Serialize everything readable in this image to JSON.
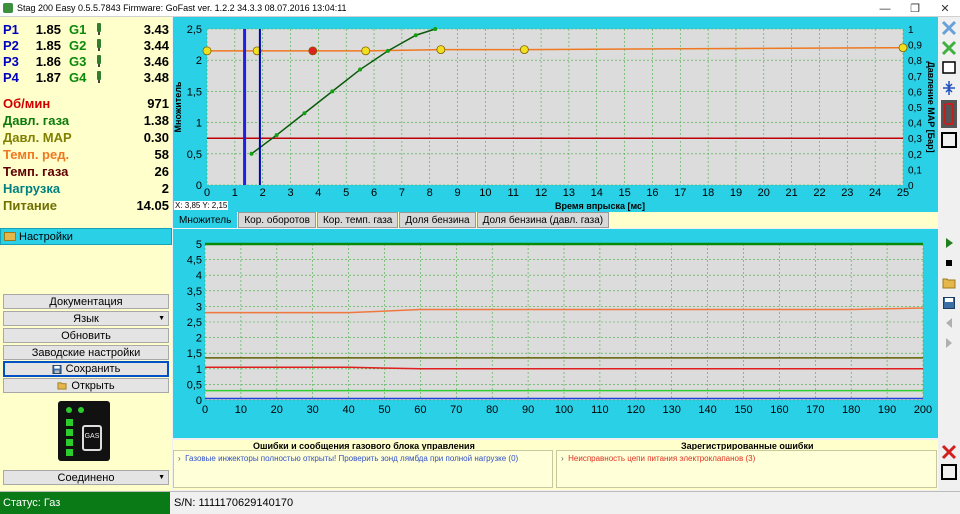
{
  "window": {
    "title": "Stag 200 Easy 0.5.5.7843 Firmware: GoFast  ver. 1.2.2  34.3.3   08.07.2016 13:04:11",
    "minimize": "—",
    "restore": "❐",
    "close": "✕"
  },
  "injectors": [
    {
      "p_label": "P1",
      "p_value": "1.85",
      "g_label": "G1",
      "g_value": "3.43"
    },
    {
      "p_label": "P2",
      "p_value": "1.85",
      "g_label": "G2",
      "g_value": "3.44"
    },
    {
      "p_label": "P3",
      "p_value": "1.86",
      "g_label": "G3",
      "g_value": "3.46"
    },
    {
      "p_label": "P4",
      "p_value": "1.87",
      "g_label": "G4",
      "g_value": "3.48"
    }
  ],
  "metrics": [
    {
      "label": "Об/мин",
      "value": "971",
      "color": "#d00000"
    },
    {
      "label": "Давл. газа",
      "value": "1.38",
      "color": "#0a7a0a"
    },
    {
      "label": "Давл. MAP",
      "value": "0.30",
      "color": "#808000"
    },
    {
      "label": "Темп. ред.",
      "value": "58",
      "color": "#f07820"
    },
    {
      "label": "Темп. газа",
      "value": "26",
      "color": "#600000"
    },
    {
      "label": "Нагрузка",
      "value": "2",
      "color": "#008080"
    },
    {
      "label": "Питание",
      "value": "14.05",
      "color": "#707000"
    }
  ],
  "sidebar": {
    "settings_label": "Настройки",
    "buttons": {
      "docs": "Документация",
      "language": "Язык",
      "update": "Обновить",
      "factory": "Заводские настройки",
      "save": "Сохранить",
      "open": "Открыть",
      "connection": "Соединено"
    },
    "device_gas": "GAS"
  },
  "chart1": {
    "ylabel": "Множитель",
    "xlabel": "Время впрыска [мс]",
    "y2label": "Давление MAP [Бар]",
    "coords": "X: 3,85  Y: 2,15"
  },
  "tabs": [
    "Множитель",
    "Кор. оборотов",
    "Кор. темп. газа",
    "Доля бензина",
    "Доля бензина (давл. газа)"
  ],
  "errors": {
    "left_title": "Ошибки и сообщения газового блока управления",
    "left_msg": "Газовые инжекторы полностью открыты! Проверить зонд лямбда при полной нагрузке (0)",
    "right_title": "Зарегистрированные ошибки",
    "right_msg": "Неисправность цепи питания электроклапанов (3)"
  },
  "status": {
    "state": "Статус: Газ",
    "serial": "S/N: 1111170629140170"
  },
  "chart_data": [
    {
      "type": "scatter",
      "xlabel": "Время впрыска [мс]",
      "ylabel": "Множитель",
      "y2label": "Давление MAP [Бар]",
      "xlim": [
        0,
        25
      ],
      "ylim": [
        0,
        2.5
      ],
      "y2lim": [
        0,
        1
      ],
      "xticks": [
        0,
        1,
        2,
        3,
        4,
        5,
        6,
        7,
        8,
        9,
        10,
        11,
        12,
        13,
        14,
        15,
        16,
        17,
        18,
        19,
        20,
        21,
        22,
        23,
        24,
        25
      ],
      "yticks": [
        "0",
        "0,5",
        "1",
        "1,5",
        "2",
        "2,5"
      ],
      "y2ticks": [
        "0",
        "0,1",
        "0,2",
        "0,3",
        "0,4",
        "0,5",
        "0,6",
        "0,7",
        "0,8",
        "0,9",
        "1"
      ],
      "multiplier_curve": {
        "x": [
          1.6,
          2.5,
          3.5,
          4.5,
          5.5,
          6.5,
          7.5,
          8.2
        ],
        "y": [
          0.5,
          0.8,
          1.15,
          1.5,
          1.85,
          2.15,
          2.4,
          2.5
        ]
      },
      "map_points": {
        "x": [
          0,
          1.8,
          3.8,
          5.7,
          8.4,
          11.4,
          25
        ],
        "y": [
          2.15,
          2.15,
          2.15,
          2.15,
          2.17,
          2.17,
          2.2
        ]
      },
      "vertical_markers_x": [
        1.35,
        1.9
      ],
      "threshold_line_y": 0.75,
      "grid": true
    },
    {
      "type": "line",
      "xlim": [
        0,
        200
      ],
      "ylim": [
        0,
        5
      ],
      "xticks": [
        0,
        10,
        20,
        30,
        40,
        50,
        60,
        70,
        80,
        90,
        100,
        110,
        120,
        130,
        140,
        150,
        160,
        170,
        180,
        190,
        200
      ],
      "yticks": [
        "0",
        "0,5",
        "1",
        "1,5",
        "2",
        "2,5",
        "3",
        "3,5",
        "4",
        "4,5",
        "5"
      ],
      "series": [
        {
          "color": "#0a8a0a",
          "values": [
            5,
            5
          ]
        },
        {
          "color": "#f07840",
          "values": [
            2.8,
            2.8,
            2.8,
            2.9,
            2.9,
            2.9,
            2.9,
            2.9,
            2.9,
            2.9,
            2.95
          ]
        },
        {
          "color": "#606000",
          "values": [
            1.35,
            1.35,
            1.35,
            1.35,
            1.35,
            1.35,
            1.35,
            1.35,
            1.35,
            1.35,
            1.35
          ]
        },
        {
          "color": "#e02020",
          "values": [
            1.05,
            1.05,
            1.05,
            1.0,
            1.0,
            1.0,
            1.0,
            1.0,
            1.0,
            1.0,
            1.0
          ]
        },
        {
          "color": "#30d030",
          "values": [
            0.3,
            0.3,
            0.3,
            0.3,
            0.3,
            0.3,
            0.3,
            0.3,
            0.3,
            0.3,
            0.3
          ]
        },
        {
          "color": "#2040e0",
          "values": [
            0.05,
            0.05,
            0.05,
            0.05,
            0.05,
            0.05,
            0.05,
            0.05,
            0.05,
            0.05,
            0.05
          ]
        }
      ],
      "grid": true
    }
  ]
}
